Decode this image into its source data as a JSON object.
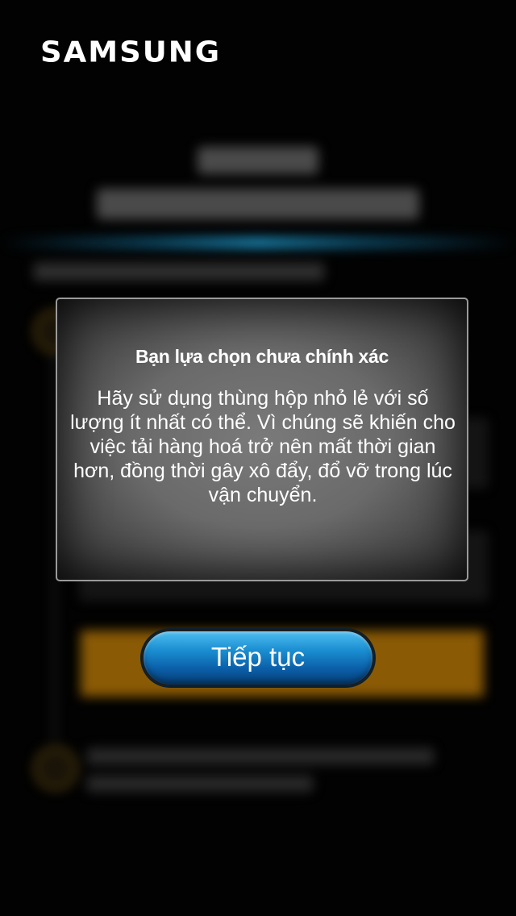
{
  "brand": {
    "logo_text": "SAMSUNG"
  },
  "dialog": {
    "title": "Bạn lựa chọn chưa chính xác",
    "body": "Hãy sử dụng thùng hộp nhỏ lẻ với số lượng ít nhất có thể. Vì chúng sẽ khiến cho việc tải hàng hoá trở nên mất thời gian hơn, đồng thời gây xô đẩy, đổ vỡ trong lúc vận chuyển."
  },
  "actions": {
    "continue_label": "Tiếp tục"
  },
  "colors": {
    "accent_blue": "#1b8fd2",
    "background": "#020202",
    "dialog_gray": "#6a6a6a",
    "blurred_orange": "#8a5a05"
  }
}
